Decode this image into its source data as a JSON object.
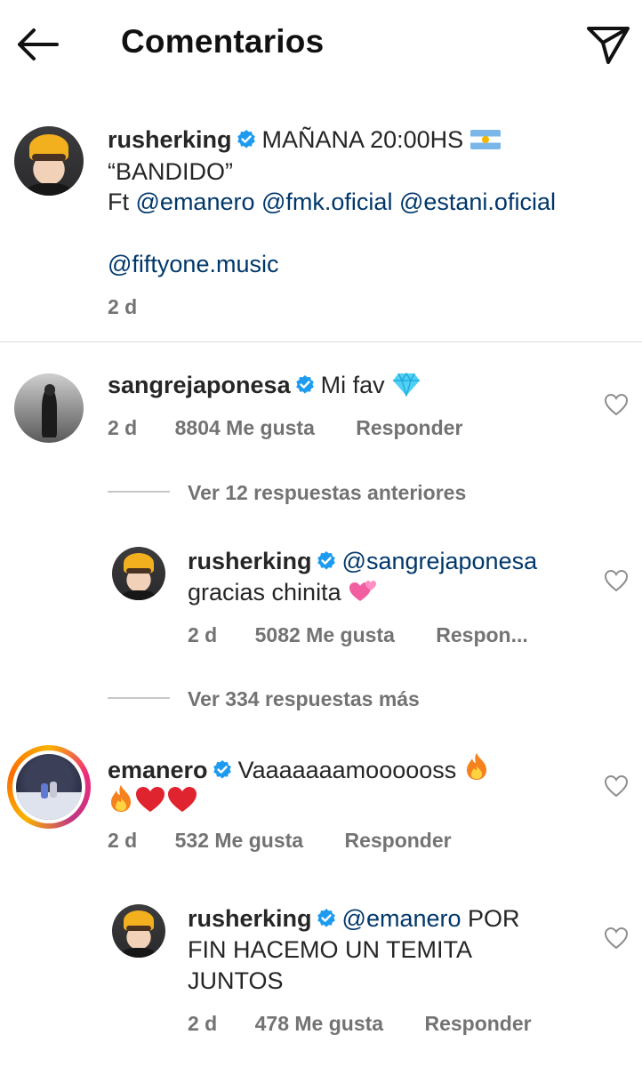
{
  "header": {
    "title": "Comentarios"
  },
  "caption": {
    "username": "rusherking",
    "line1_text": "MAÑANA 20:00HS",
    "line2_text": "“BANDIDO”",
    "line3_prefix": "Ft",
    "mentions": [
      "@emanero",
      "@fmk.oficial",
      "@estani.oficial",
      "@fiftyone.music"
    ],
    "time": "2 d"
  },
  "comments": [
    {
      "username": "sangrejaponesa",
      "text": "Mi fav",
      "time": "2 d",
      "likes": "8804 Me gusta",
      "reply_label": "Responder",
      "view_replies": "Ver 12 respuestas anteriores",
      "replies": [
        {
          "username": "rusherking",
          "mention": "@sangrejaponesa",
          "text": "gracias chinita",
          "time": "2 d",
          "likes": "5082 Me gusta",
          "reply_label": "Respon..."
        }
      ],
      "view_more": "Ver 334 respuestas más"
    },
    {
      "username": "emanero",
      "text": "Vaaaaaaamoooooss",
      "time": "2 d",
      "likes": "532 Me gusta",
      "reply_label": "Responder",
      "replies": [
        {
          "username": "rusherking",
          "mention": "@emanero",
          "text_line1": "POR",
          "text_line2": "FIN HACEMO UN TEMITA",
          "text_line3": "JUNTOS",
          "time": "2 d",
          "likes": "478 Me gusta",
          "reply_label": "Responder"
        }
      ]
    }
  ],
  "icons": {
    "back": "arrow-left-icon",
    "send": "paper-plane-icon",
    "verified": "verified-badge-icon",
    "like": "heart-outline-icon"
  },
  "colors": {
    "verified": "#1d9bf0",
    "mention": "#00376b",
    "meta": "#737373"
  }
}
